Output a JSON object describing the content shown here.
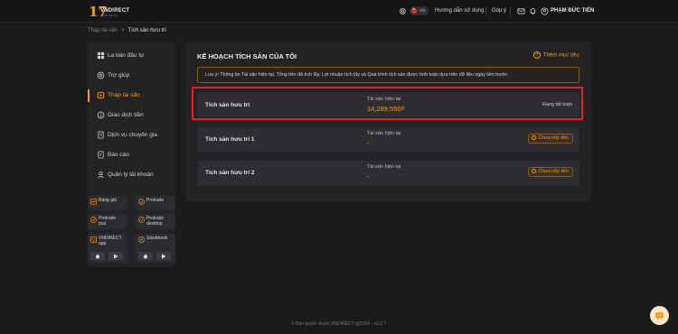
{
  "header": {
    "logo_number": "17",
    "logo_brand": "VNDIRECT",
    "logo_tagline": "Đối tác chiến lược",
    "lang_code": "VN",
    "guide_label": "Hướng dẫn sử dụng",
    "feedback_label": "Góp ý",
    "user_name": "PHẠM ĐỨC TIẾN"
  },
  "breadcrumb": {
    "parent": "Tháp tài sản",
    "separator": ">",
    "current": "Tích sản hưu trí"
  },
  "sidebar": {
    "items": [
      {
        "label": "La bàn đầu tư",
        "icon": "compass-icon"
      },
      {
        "label": "Trợ giúp",
        "icon": "help-icon"
      },
      {
        "label": "Tháp tài sản",
        "icon": "tower-icon",
        "active": true
      },
      {
        "label": "Giao dịch tiền",
        "icon": "money-icon"
      },
      {
        "label": "Dịch vụ chuyên gia",
        "icon": "expert-icon"
      },
      {
        "label": "Báo cáo",
        "icon": "report-icon"
      },
      {
        "label": "Quản lý tài khoản",
        "icon": "account-icon"
      }
    ],
    "apps": [
      {
        "label": "Bảng giá"
      },
      {
        "label": "Protrade"
      },
      {
        "label": "Protrade\ntrial"
      },
      {
        "label": "Protrade\ndesktop"
      }
    ],
    "stores": [
      {
        "label": "VNDIRECT\napp"
      },
      {
        "label": "Stockbook"
      }
    ]
  },
  "main": {
    "title": "KẾ HOẠCH TÍCH SẢN CỦA TÔI",
    "add_label": "Thêm mục tiêu",
    "notice": "Lưu ý: Thông tin Tài sản hiện tại, Tổng tiền đã tích lũy, Lợi nhuận tích lũy và Quá trình tích sản được tính toán dựa trên dữ liệu ngày liền trước.",
    "rows": [
      {
        "name": "Tích sản hưu trí",
        "caption": "Tài sản hiện tại",
        "value": "14,289,550₫",
        "status": "Đang tất toán"
      },
      {
        "name": "Tích sản hưu trí 1",
        "caption": "Tài sản hiện tại",
        "value": "-",
        "badge": "Chưa nộp tiền"
      },
      {
        "name": "Tích sản hưu trí 2",
        "caption": "Tài sản hiện tại",
        "value": "-",
        "badge": "Chưa nộp tiền"
      }
    ]
  },
  "footer": {
    "text": "Bản quyền thuộc VNDIRECT @2024 - v3.1.7"
  },
  "colors": {
    "accent": "#f59b1c",
    "background": "#1b1b1c",
    "panel": "#232326",
    "highlight": "#e0202b"
  }
}
